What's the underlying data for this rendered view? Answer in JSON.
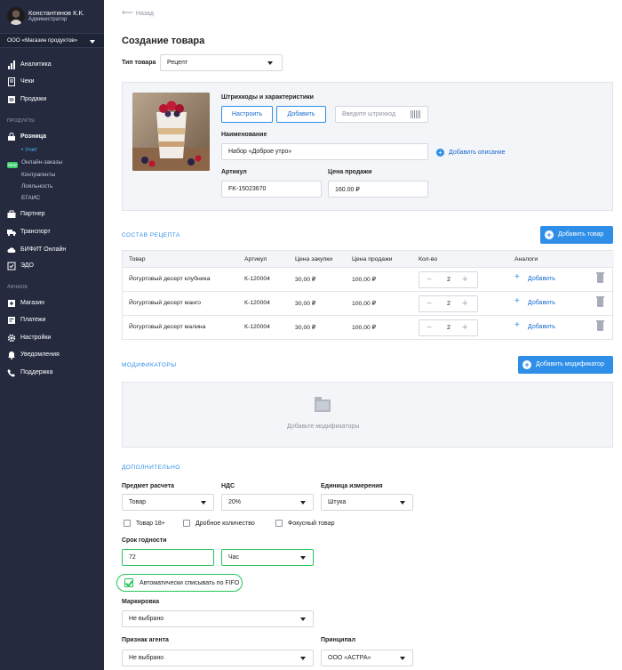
{
  "sidebar": {
    "user_name": "Константинов К.К.",
    "user_role": "Администратор",
    "store": "ООО «Магазин продуктов»",
    "top_items": [
      {
        "label": "Аналитика",
        "icon": "chart-icon"
      },
      {
        "label": "Чеки",
        "icon": "receipt-icon"
      },
      {
        "label": "Продажи",
        "icon": "sales-icon"
      }
    ],
    "section_products": "ПРОДУКТЫ",
    "retail": "Розница",
    "retail_sub": [
      "Учет",
      "Онлайн-заказы",
      "Контрагенты",
      "Лояльность",
      "ЕГАИС"
    ],
    "new_badge": "NEW",
    "product_items": [
      {
        "label": "Партнер",
        "icon": "partner-icon"
      },
      {
        "label": "Транспорт",
        "icon": "truck-icon"
      },
      {
        "label": "БИФИТ Онлайн",
        "icon": "cloud-icon"
      },
      {
        "label": "ЭДО",
        "icon": "edo-icon"
      }
    ],
    "section_personal": "ЛИЧНОЕ",
    "personal_items": [
      {
        "label": "Магазин",
        "icon": "store-icon"
      },
      {
        "label": "Платежи",
        "icon": "payment-icon"
      },
      {
        "label": "Настройки",
        "icon": "gear-icon"
      },
      {
        "label": "Уведомления",
        "icon": "bell-icon"
      },
      {
        "label": "Поддержка",
        "icon": "phone-icon"
      }
    ]
  },
  "header": {
    "back": "Назад",
    "title": "Создание товара"
  },
  "product_type": {
    "label": "Тип товара",
    "value": "Рецепт"
  },
  "card": {
    "barcodes_label": "Штрихкоды и характеристики",
    "configure_button": "Настроить",
    "add_button": "Добавить",
    "barcode_placeholder": "Введите штрихкод",
    "name_label": "Наименование",
    "name_value": "Набор «Доброе утро»",
    "add_description": "Добавить описание",
    "sku_label": "Артикул",
    "sku_value": "FK-15023670",
    "price_label": "Цена продажи",
    "price_value": "160.00 ₽"
  },
  "recipe": {
    "heading": "СОСТАВ РЕЦЕПТА",
    "add_button": "Добавить товар",
    "columns": [
      "Товар",
      "Артикул",
      "Цена закупки",
      "Цена продажи",
      "Кол-во",
      "Аналоги"
    ],
    "rows": [
      {
        "name": "Йогуртовый десерт клубника",
        "sku": "К-120004",
        "purchase": "30,00 ₽",
        "sale": "100,00 ₽",
        "qty": "2",
        "analog": "Добавить"
      },
      {
        "name": "Йогуртовый десерт манго",
        "sku": "К-120004",
        "purchase": "30,00 ₽",
        "sale": "100,00 ₽",
        "qty": "2",
        "analog": "Добавить"
      },
      {
        "name": "Йогуртовый десерт малина",
        "sku": "К-120004",
        "purchase": "30,00 ₽",
        "sale": "100,00 ₽",
        "qty": "2",
        "analog": "Добавить"
      }
    ]
  },
  "modifiers": {
    "heading": "МОДИФИКАТОРЫ",
    "add_button": "Добавить модификатор",
    "empty_text": "Добавьте модификаторы"
  },
  "extra": {
    "heading": "ДОПОЛНИТЕЛЬНО",
    "calc_subject_label": "Предмет расчета",
    "calc_subject_value": "Товар",
    "vat_label": "НДС",
    "vat_value": "20%",
    "unit_label": "Единица измерения",
    "unit_value": "Штука",
    "checkboxes": [
      "Товар 18+",
      "Дробное количество",
      "Фокусный товар"
    ],
    "shelf_life_label": "Срок годности",
    "shelf_life_value": "72",
    "shelf_life_unit": "Час",
    "fifo_label": "Автоматически списывать по FIFO",
    "marking_label": "Маркировка",
    "marking_value": "Не выбрано",
    "agent_label": "Признак агента",
    "agent_value": "Не выбрано",
    "principal_label": "Принципал",
    "principal_value": "ООО «АСТРА»"
  },
  "colors": {
    "accent": "#2f8fe8",
    "sidebar": "#252a3f",
    "success": "#26c55b"
  }
}
